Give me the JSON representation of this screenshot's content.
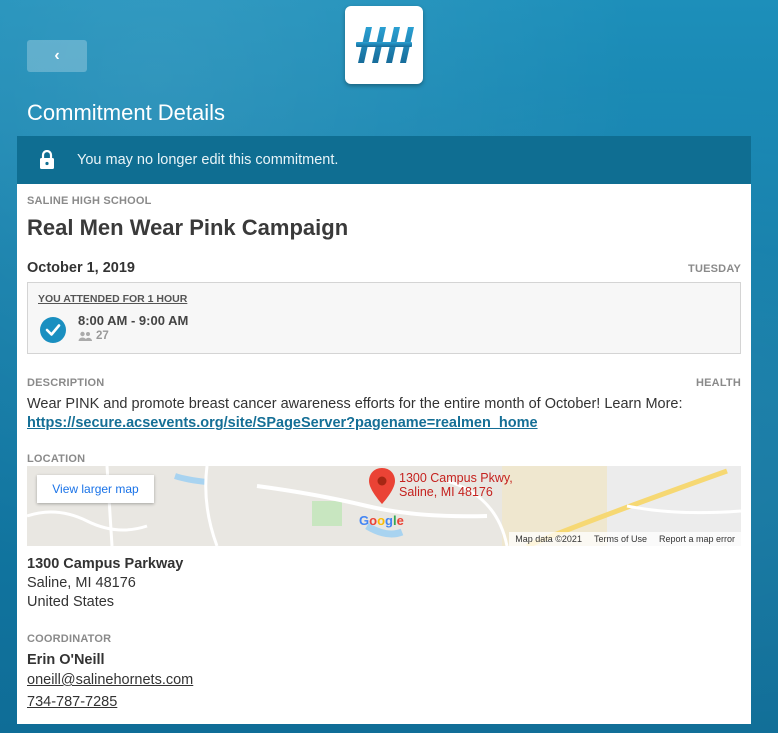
{
  "header": {
    "back_label": "‹",
    "title": "Commitment Details"
  },
  "notice": {
    "text": "You may no longer edit this commitment."
  },
  "event": {
    "organization": "SALINE HIGH SCHOOL",
    "title": "Real Men Wear Pink Campaign",
    "date": "October 1, 2019",
    "weekday": "TUESDAY"
  },
  "attendance": {
    "label": "YOU ATTENDED FOR 1 HOUR",
    "time": "8:00 AM - 9:00 AM",
    "count": "27"
  },
  "description": {
    "label": "DESCRIPTION",
    "category": "HEALTH",
    "text": "Wear PINK and promote breast cancer awareness efforts for the entire month of October! Learn More: ",
    "link": "https://secure.acsevents.org/site/SPageServer?pagename=realmen_home"
  },
  "location": {
    "label": "LOCATION",
    "map_button": "View larger map",
    "map_pin_line1": "1300 Campus Pkwy,",
    "map_pin_line2": "Saline, MI 48176",
    "map_brand": "Google",
    "map_data": "Map data ©2021",
    "map_terms": "Terms of Use",
    "map_report": "Report a map error",
    "street": "1300 Campus Parkway",
    "city": "Saline, MI 48176",
    "country": "United States"
  },
  "coordinator": {
    "label": "COORDINATOR",
    "name": "Erin O'Neill",
    "email": "oneill@salinehornets.com",
    "phone": "734-787-7285"
  },
  "colors": {
    "brand": "#1a8fc0",
    "notice_bg": "#0f6e92",
    "link": "#156f96"
  }
}
